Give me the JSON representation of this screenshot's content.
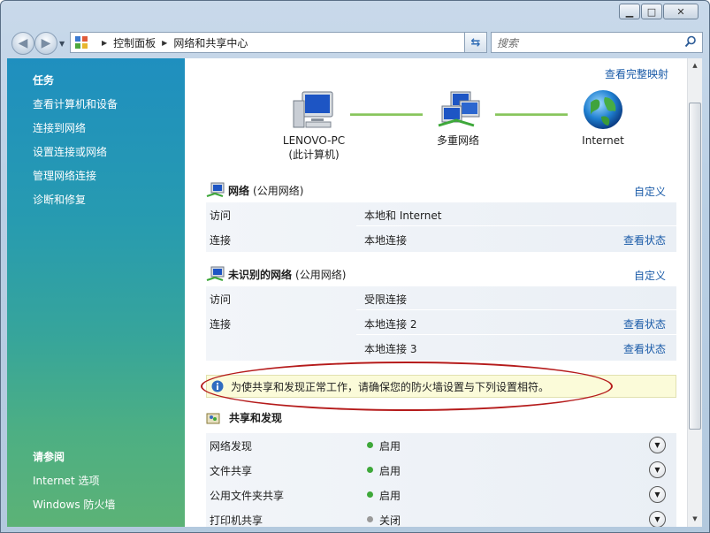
{
  "window": {
    "minimize_glyph": "▭",
    "maximize_glyph": "□",
    "close_glyph": "✕"
  },
  "address_bar": {
    "breadcrumb": [
      "控制面板",
      "网络和共享中心"
    ]
  },
  "search": {
    "placeholder": "搜索"
  },
  "sidebar": {
    "title": "任务",
    "items": [
      {
        "label": "查看计算机和设备"
      },
      {
        "label": "连接到网络"
      },
      {
        "label": "设置连接或网络"
      },
      {
        "label": "管理网络连接"
      },
      {
        "label": "诊断和修复"
      }
    ],
    "see_also_title": "请参阅",
    "see_also": [
      {
        "label": "Internet 选项"
      },
      {
        "label": "Windows 防火墙"
      }
    ]
  },
  "main": {
    "full_map_link": "查看完整映射",
    "map": {
      "computer_name": "LENOVO-PC",
      "computer_note": "(此计算机)",
      "network": "多重网络",
      "internet": "Internet"
    },
    "networks": [
      {
        "name": "网络",
        "type": "(公用网络)",
        "customize": "自定义",
        "rows": [
          {
            "key": "访问",
            "value": "本地和 Internet",
            "action": ""
          },
          {
            "key": "连接",
            "value": "本地连接",
            "action": "查看状态"
          }
        ]
      },
      {
        "name": "未识别的网络",
        "type": "(公用网络)",
        "customize": "自定义",
        "rows": [
          {
            "key": "访问",
            "value": "受限连接",
            "action": ""
          },
          {
            "key": "连接",
            "value": "本地连接 2",
            "action": "查看状态"
          },
          {
            "key": "",
            "value": "本地连接 3",
            "action": "查看状态"
          }
        ]
      }
    ],
    "info_message": "为使共享和发现正常工作，请确保您的防火墙设置与下列设置相符。",
    "sharing": {
      "title": "共享和发现",
      "rows": [
        {
          "key": "网络发现",
          "state": "启用",
          "status_color": "#3ea83a"
        },
        {
          "key": "文件共享",
          "state": "启用",
          "status_color": "#3ea83a"
        },
        {
          "key": "公用文件夹共享",
          "state": "启用",
          "status_color": "#3ea83a"
        },
        {
          "key": "打印机共享",
          "state": "关闭",
          "status_color": "#9a9a9a"
        }
      ]
    }
  },
  "colors": {
    "link": "#1a5ba8",
    "annotation_ellipse": "#b51b1b",
    "sidebar_top": "#1f8fbf",
    "sidebar_bottom": "#5cb276"
  }
}
